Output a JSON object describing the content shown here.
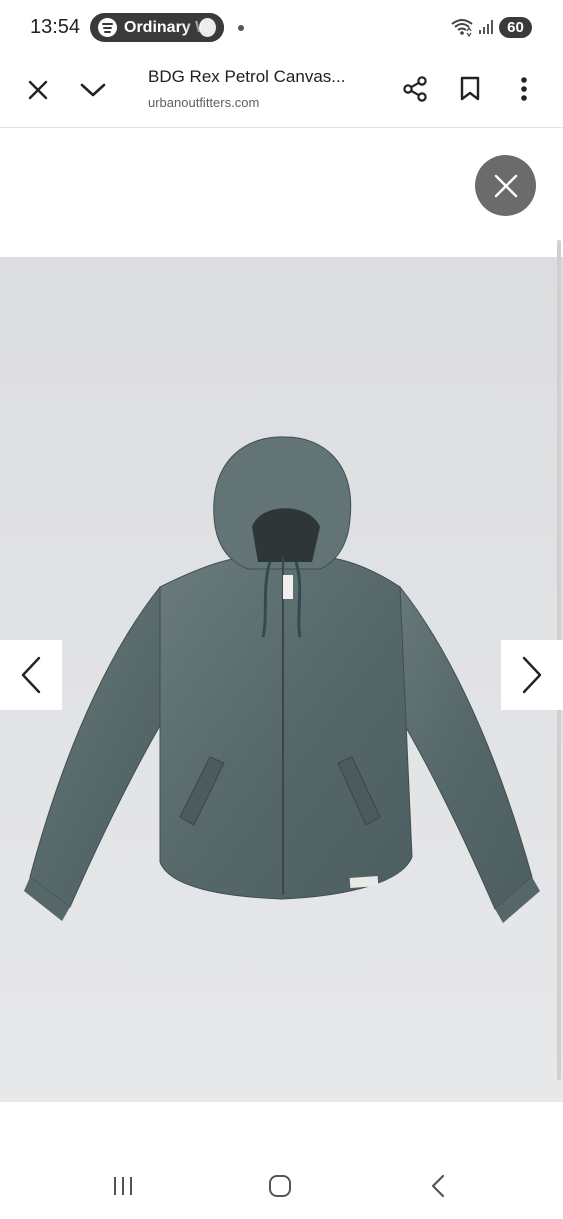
{
  "status_bar": {
    "time": "13:54",
    "media_label": "Ordinary W",
    "battery": "60"
  },
  "toolbar": {
    "title": "BDG Rex Petrol Canvas...",
    "url": "urbanoutfitters.com"
  },
  "product_image": {
    "subject": "Petrol blue washed canvas hooded zip jacket",
    "background_color": "#e2e3e5",
    "jacket_color": "#5c6e70"
  },
  "icons": {
    "close": "close-icon",
    "collapse": "chevron-down-icon",
    "share": "share-icon",
    "bookmark": "bookmark-icon",
    "menu": "more-vert-icon",
    "prev": "chevron-left-icon",
    "next": "chevron-right-icon"
  }
}
